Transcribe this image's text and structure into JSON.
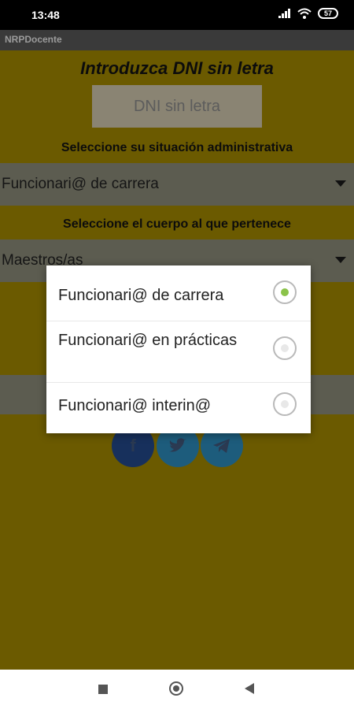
{
  "status_bar": {
    "time": "13:48",
    "battery": "57"
  },
  "app": {
    "title": "NRPDocente"
  },
  "form": {
    "heading": "Introduzca DNI sin letra",
    "dni_placeholder": "DNI sin letra",
    "situation_label": "Seleccione su situación administrativa",
    "situation_value": "Funcionari@ de carrera",
    "body_label": "Seleccione el cuerpo al que pertenece",
    "body_value": "Maestros/as"
  },
  "dialog": {
    "options": [
      {
        "label": "Funcionari@ de carrera",
        "selected": true
      },
      {
        "label": "Funcionari@ en prácticas",
        "selected": false
      },
      {
        "label": "Funcionari@ interin@",
        "selected": false
      }
    ]
  },
  "colors": {
    "background": "#6b5a00",
    "accent": "#8bc34a"
  },
  "icons": [
    "signal-icon",
    "wifi-icon",
    "battery-icon",
    "facebook-icon",
    "twitter-icon",
    "telegram-icon"
  ]
}
